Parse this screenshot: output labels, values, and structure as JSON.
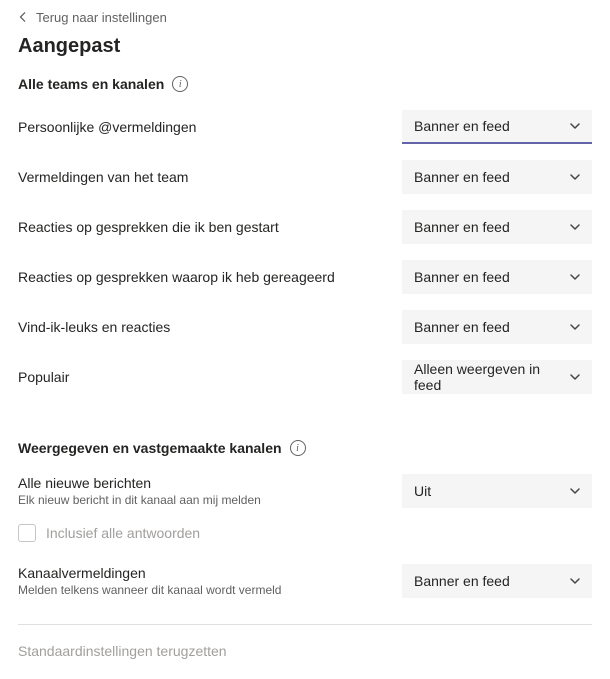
{
  "back": {
    "label": "Terug naar instellingen"
  },
  "page_title": "Aangepast",
  "section1": {
    "title": "Alle teams en kanalen",
    "rows": [
      {
        "label": "Persoonlijke @vermeldingen",
        "value": "Banner en feed"
      },
      {
        "label": "Vermeldingen van het team",
        "value": "Banner en feed"
      },
      {
        "label": "Reacties op gesprekken die ik ben gestart",
        "value": "Banner en feed"
      },
      {
        "label": "Reacties op gesprekken waarop ik heb gereageerd",
        "value": "Banner en feed"
      },
      {
        "label": "Vind-ik-leuks en reacties",
        "value": "Banner en feed"
      },
      {
        "label": "Populair",
        "value": "Alleen weergeven in feed"
      }
    ]
  },
  "section2": {
    "title": "Weergegeven en vastgemaakte kanalen",
    "row_new_messages": {
      "label": "Alle nieuwe berichten",
      "sublabel": "Elk nieuw bericht in dit kanaal aan mij melden",
      "value": "Uit"
    },
    "checkbox_replies": {
      "label": "Inclusief alle antwoorden"
    },
    "row_channel_mentions": {
      "label": "Kanaalvermeldingen",
      "sublabel": "Melden telkens wanneer dit kanaal wordt vermeld",
      "value": "Banner en feed"
    }
  },
  "reset_label": "Standaardinstellingen terugzetten",
  "info_glyph": "i"
}
